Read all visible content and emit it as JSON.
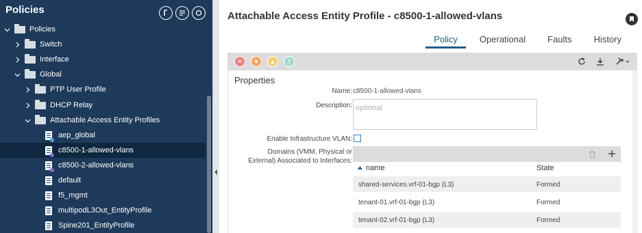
{
  "nav": {
    "title": "Policies",
    "tree": [
      {
        "label": "Policies",
        "kind": "folder",
        "expanded": true
      },
      {
        "label": "Switch",
        "kind": "folder",
        "expanded": false
      },
      {
        "label": "Interface",
        "kind": "folder",
        "expanded": false
      },
      {
        "label": "Global",
        "kind": "folder",
        "expanded": true
      },
      {
        "label": "PTP User Profile",
        "kind": "folder",
        "expanded": false
      },
      {
        "label": "DHCP Relay",
        "kind": "folder",
        "expanded": false
      },
      {
        "label": "Attachable Access Entity Profiles",
        "kind": "folder",
        "expanded": true
      },
      {
        "label": "aep_global",
        "kind": "doc"
      },
      {
        "label": "c8500-1-allowed-vlans",
        "kind": "doc",
        "selected": true
      },
      {
        "label": "c8500-2-allowed-vlans",
        "kind": "doc"
      },
      {
        "label": "default",
        "kind": "doc"
      },
      {
        "label": "f5_mgmt",
        "kind": "doc"
      },
      {
        "label": "multipodL3Out_EntityProfile",
        "kind": "doc"
      },
      {
        "label": "Spine201_EntityProfile",
        "kind": "doc"
      }
    ]
  },
  "header": {
    "title": "Attachable Access Entity Profile - c8500-1-allowed-vlans"
  },
  "tabs": [
    {
      "label": "Policy",
      "active": true
    },
    {
      "label": "Operational"
    },
    {
      "label": "Faults"
    },
    {
      "label": "History"
    }
  ],
  "properties": {
    "heading": "Properties",
    "name_label": "Name:",
    "name_value": "c8500-1-allowed-vlans",
    "description_label": "Description:",
    "description_placeholder": "optional",
    "infra_vlan_label": "Enable Infrastructure VLAN:",
    "domains_label_1": "Domains (VMM, Physical or",
    "domains_label_2": "External) Associated to Interfaces:",
    "domains_columns": {
      "name": "name",
      "state": "State"
    },
    "domains": [
      {
        "name": "shared-services.vrf-01-bgp (L3)",
        "state": "Formed"
      },
      {
        "name": "tenant-01.vrf-01-bgp (L3)",
        "state": "Formed"
      },
      {
        "name": "tenant-02.vrf-01-bgp (L3)",
        "state": "Formed"
      }
    ]
  },
  "colors": {
    "nav_bg": "#1e3a5a",
    "accent": "#1e5d8c",
    "fault_critical": "#f08080",
    "fault_major": "#f4a460",
    "fault_minor": "#f0d070",
    "fault_warning": "#a8d8d0"
  }
}
